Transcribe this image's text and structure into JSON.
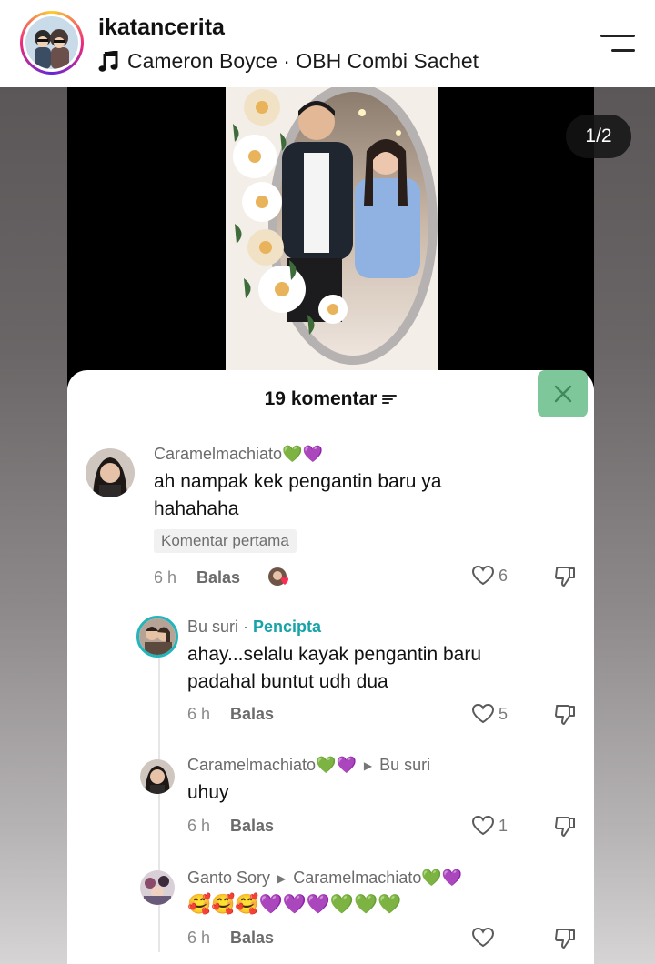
{
  "header": {
    "username": "ikatancerita",
    "music": "Cameron Boyce · OBH Combi Sachet"
  },
  "post": {
    "page_counter": "1/2"
  },
  "comments_sheet": {
    "title": "19 komentar",
    "comments": [
      {
        "author": "Caramelmachiato",
        "author_emoji": "💚💜",
        "text_line1": "ah nampak kek pengantin baru ya",
        "text_line2": "hahahaha",
        "badge": "Komentar pertama",
        "time": "6 h",
        "reply_label": "Balas",
        "likes": "6"
      },
      {
        "author": "Bu suri",
        "creator_label": "Pencipta",
        "text_line1": "ahay...selalu kayak pengantin baru",
        "text_line2": "padahal buntut udh dua",
        "time": "6 h",
        "reply_label": "Balas",
        "likes": "5"
      },
      {
        "author": "Caramelmachiato",
        "author_emoji": "💚💜",
        "reply_to": "Bu suri",
        "text_line1": "uhuy",
        "time": "6 h",
        "reply_label": "Balas",
        "likes": "1"
      },
      {
        "author": "Ganto Sory",
        "reply_to": "Caramelmachiato",
        "reply_to_emoji": "💚💜",
        "text_line1": "🥰🥰🥰💜💜💜💚💚💚",
        "time": "6 h",
        "reply_label": "Balas",
        "likes": ""
      }
    ]
  },
  "icons": {
    "menu": "hamburger-menu-icon",
    "music": "music-note-icon",
    "sort": "sort-icon",
    "close": "close-icon",
    "like": "heart-outline-icon",
    "dislike": "thumbs-down-icon"
  },
  "colors": {
    "creator_label": "#18a3a8",
    "close_button": "#7ec79a"
  }
}
